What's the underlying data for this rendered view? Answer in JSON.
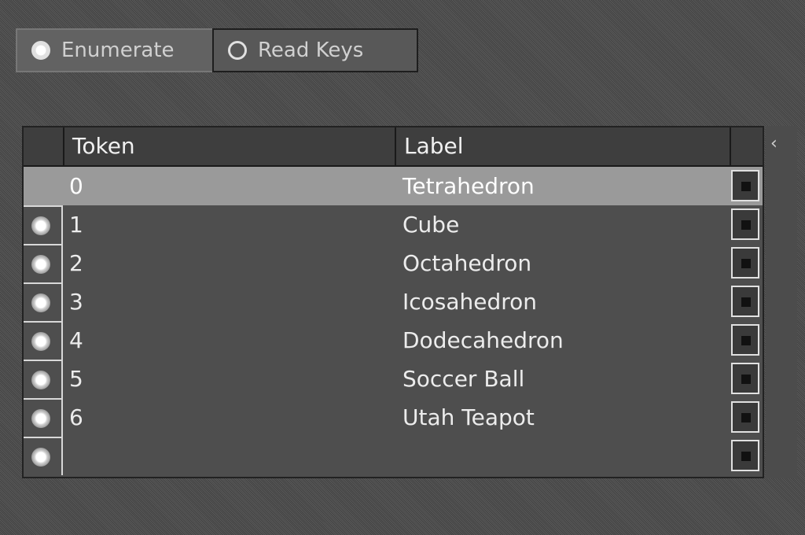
{
  "tabs": [
    {
      "label": "Enumerate",
      "selected": true
    },
    {
      "label": "Read Keys",
      "selected": false
    }
  ],
  "table": {
    "columns": [
      "",
      "Token",
      "Label",
      ""
    ],
    "selected_index": 0,
    "rows": [
      {
        "token": "0",
        "label": "Tetrahedron"
      },
      {
        "token": "1",
        "label": "Cube"
      },
      {
        "token": "2",
        "label": "Octahedron"
      },
      {
        "token": "3",
        "label": "Icosahedron"
      },
      {
        "token": "4",
        "label": "Dodecahedron"
      },
      {
        "token": "5",
        "label": "Soccer Ball"
      },
      {
        "token": "6",
        "label": "Utah Teapot"
      },
      {
        "token": "",
        "label": ""
      }
    ]
  },
  "scroll": {
    "arrow_icon": "chevron-left-icon"
  }
}
